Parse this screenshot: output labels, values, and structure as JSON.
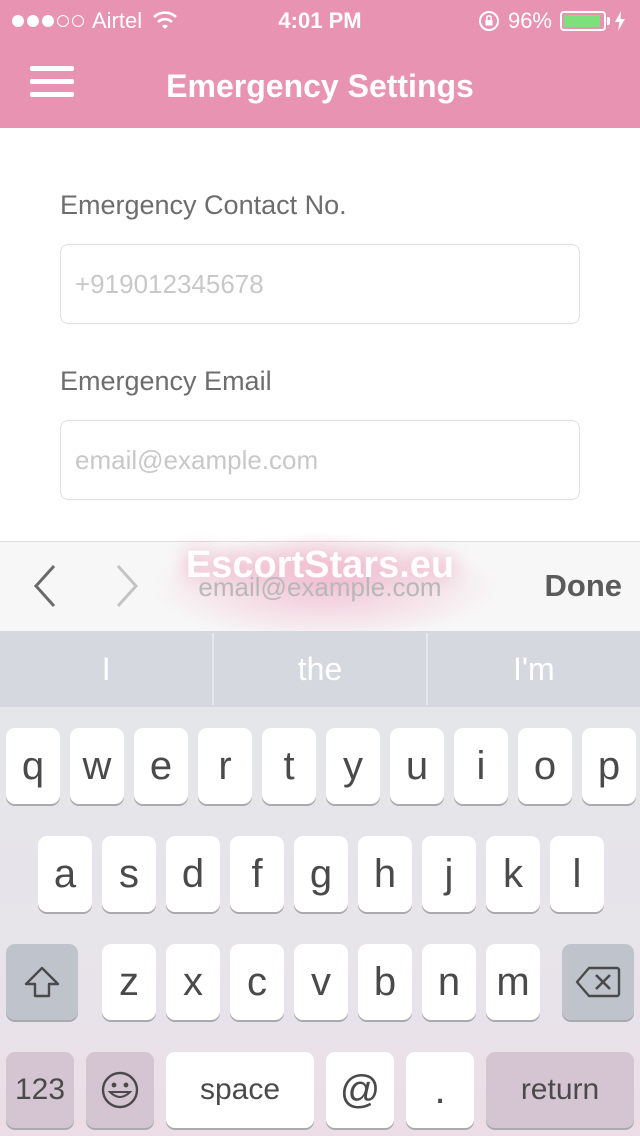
{
  "status_bar": {
    "carrier": "Airtel",
    "time": "4:01 PM",
    "battery": "96%",
    "battery_level": 0.96,
    "signal_bars_filled": 3,
    "signal_bars_total": 5
  },
  "nav": {
    "title": "Emergency Settings",
    "menu_icon": "hamburger-menu-icon"
  },
  "form": {
    "contact_label": "Emergency Contact No.",
    "contact_placeholder": "+919012345678",
    "contact_value": "",
    "email_label": "Emergency Email",
    "email_placeholder": "email@example.com",
    "email_value": ""
  },
  "accessory": {
    "prev_icon": "chevron-left-icon",
    "next_icon": "chevron-right-icon",
    "field_preview": "email@example.com",
    "watermark": "EscortStars.eu",
    "done_label": "Done"
  },
  "suggestions": [
    "I",
    "the",
    "I'm"
  ],
  "keyboard": {
    "row1": [
      "q",
      "w",
      "e",
      "r",
      "t",
      "y",
      "u",
      "i",
      "o",
      "p"
    ],
    "row2": [
      "a",
      "s",
      "d",
      "f",
      "g",
      "h",
      "j",
      "k",
      "l"
    ],
    "row3": [
      "z",
      "x",
      "c",
      "v",
      "b",
      "n",
      "m"
    ],
    "numbers_label": "123",
    "space_label": "space",
    "at_label": "@",
    "dot_label": ".",
    "return_label": "return",
    "shift_icon": "shift-icon",
    "delete_icon": "backspace-icon",
    "emoji_icon": "emoji-icon"
  },
  "colors": {
    "header": "#e893b1",
    "battery_fill": "#7ce07c",
    "accent": "#e893b1"
  }
}
